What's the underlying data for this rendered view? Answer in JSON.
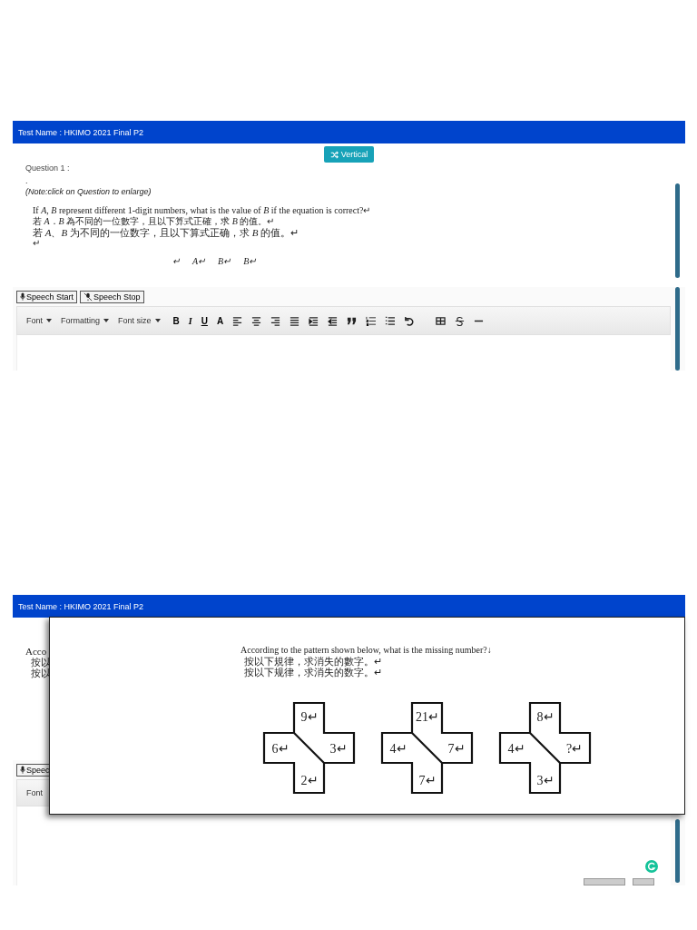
{
  "top_screen": {
    "test_name": "Test Name : HKIMO 2021 Final P2",
    "layout_button": "Vertical",
    "question_label": "Question 1 :",
    "dot": ".",
    "note": "(Note:click on Question to enlarge)",
    "question_lines": [
      "If *A*, *B* represent different 1-digit numbers, what is the value of *B* if the equation is correct?↵",
      "若 *A*．*B* 為不同的一位數字，且以下算式正確，求 *B* 的值。↵",
      "若 *A*、*B* 为不同的一位数字，且以下算式正确，求 *B* 的值。↵",
      "↵"
    ],
    "equation_marks": [
      "↵",
      "A↵",
      "B↵",
      "B↵"
    ],
    "speech_buttons": [
      {
        "label": "Speech Start",
        "kind": "start"
      },
      {
        "label": "Speech Stop",
        "kind": "stop"
      }
    ],
    "toolbar": {
      "dropdowns": [
        "Font",
        "Formatting",
        "Font size"
      ],
      "letters": [
        {
          "text": "B",
          "kind": "bold"
        },
        {
          "text": "I",
          "kind": "italic"
        },
        {
          "text": "U",
          "kind": "underline"
        },
        {
          "text": "A",
          "kind": "color"
        }
      ]
    }
  },
  "bottom_screen": {
    "test_name": "Test Name : HKIMO 2021 Final P2",
    "background_lines": [
      "Acco",
      "按以",
      "按以"
    ],
    "speech_button": "Speec",
    "toolbar_dropdown": "Font",
    "modal": {
      "question_lines": [
        "According to the pattern shown below, what is the missing number?↓",
        "按以下規律，求消失的數字。↵",
        "按以下规律，求消失的数字。↵"
      ],
      "crosses": [
        {
          "top": "9↵",
          "left": "6↵",
          "right": "3↵",
          "bottom": "2↵"
        },
        {
          "top": "21↵",
          "left": "4↵",
          "right": "7↵",
          "bottom": "7↵"
        },
        {
          "top": "8↵",
          "left": "4↵",
          "right": "?↵",
          "bottom": "3↵"
        }
      ]
    }
  }
}
